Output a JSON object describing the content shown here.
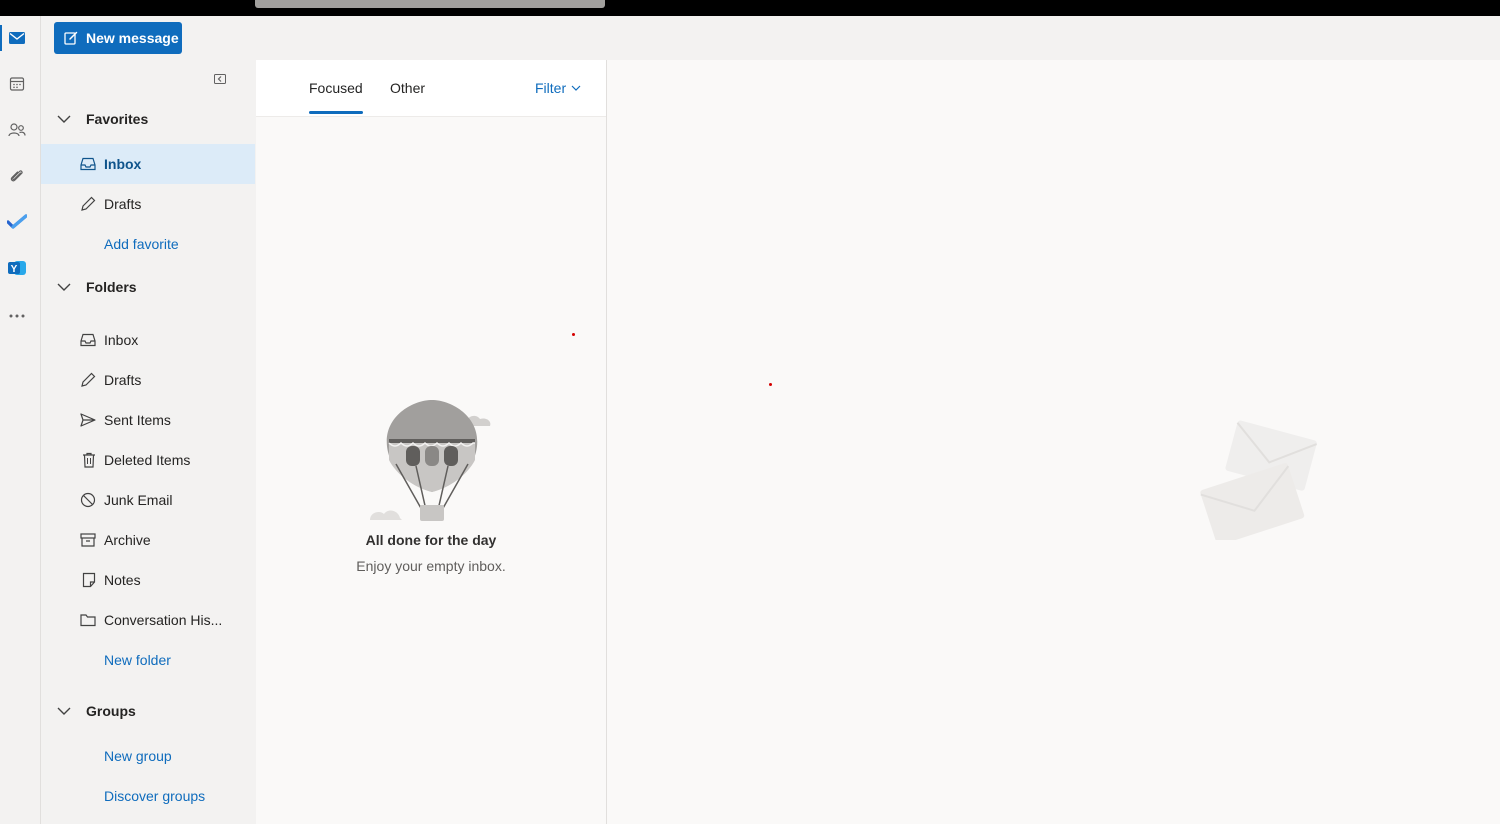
{
  "app": {
    "new_message_label": "New message"
  },
  "rail": {
    "items": [
      {
        "icon": "mail-icon",
        "active": true
      },
      {
        "icon": "calendar-icon"
      },
      {
        "icon": "people-icon"
      },
      {
        "icon": "attachment-icon"
      },
      {
        "icon": "todo-check-icon"
      },
      {
        "icon": "yammer-icon"
      },
      {
        "icon": "more-apps-icon"
      }
    ]
  },
  "folders": {
    "favorites_label": "Favorites",
    "favorites": [
      {
        "label": "Inbox",
        "icon": "inbox-icon",
        "selected": true
      },
      {
        "label": "Drafts",
        "icon": "pencil-icon"
      }
    ],
    "add_favorite_label": "Add favorite",
    "folders_label": "Folders",
    "items": [
      {
        "label": "Inbox",
        "icon": "inbox-icon"
      },
      {
        "label": "Drafts",
        "icon": "pencil-icon"
      },
      {
        "label": "Sent Items",
        "icon": "send-icon"
      },
      {
        "label": "Deleted Items",
        "icon": "trash-icon"
      },
      {
        "label": "Junk Email",
        "icon": "block-icon"
      },
      {
        "label": "Archive",
        "icon": "archive-icon"
      },
      {
        "label": "Notes",
        "icon": "note-icon"
      },
      {
        "label": "Conversation His...",
        "icon": "folder-icon"
      }
    ],
    "new_folder_label": "New folder",
    "groups_label": "Groups",
    "new_group_label": "New group",
    "discover_groups_label": "Discover groups"
  },
  "message_list": {
    "tabs": [
      {
        "label": "Focused",
        "active": true
      },
      {
        "label": "Other"
      }
    ],
    "filter_label": "Filter",
    "empty_title": "All done for the day",
    "empty_subtitle": "Enjoy your empty inbox."
  },
  "colors": {
    "accent": "#0f6cbd",
    "selected_bg": "#dcebf8",
    "pane_bg": "#f3f2f1"
  }
}
